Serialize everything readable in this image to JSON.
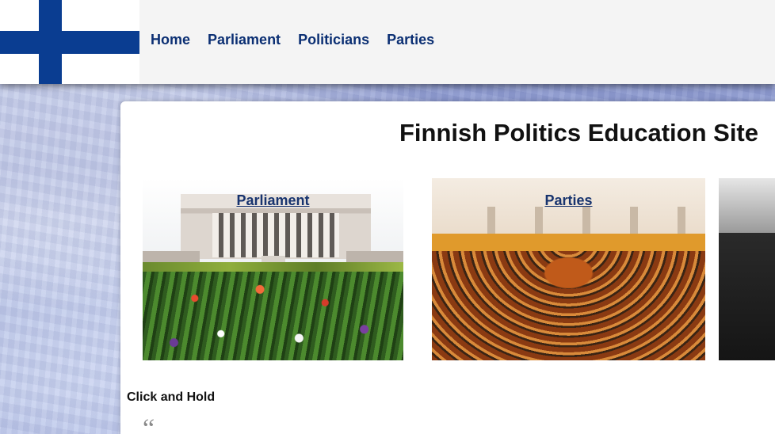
{
  "header": {
    "flag_colors": {
      "cross": "#0a3d91",
      "field": "#ffffff"
    },
    "nav": [
      {
        "label": "Home"
      },
      {
        "label": "Parliament"
      },
      {
        "label": "Politicians"
      },
      {
        "label": "Parties"
      }
    ]
  },
  "main": {
    "title": "Finnish Politics Education Site",
    "tiles": [
      {
        "label": "Parliament",
        "image": "parliament-building-photo"
      },
      {
        "label": "Parties",
        "image": "parliament-chamber-photo"
      },
      {
        "label": "",
        "image": "partial-dark-photo"
      }
    ],
    "click_hold_label": "Click and Hold",
    "quote_mark": "“"
  },
  "colors": {
    "nav_text": "#0b2f73",
    "tile_caption": "#17336e",
    "header_bg": "#f4f4f4"
  }
}
